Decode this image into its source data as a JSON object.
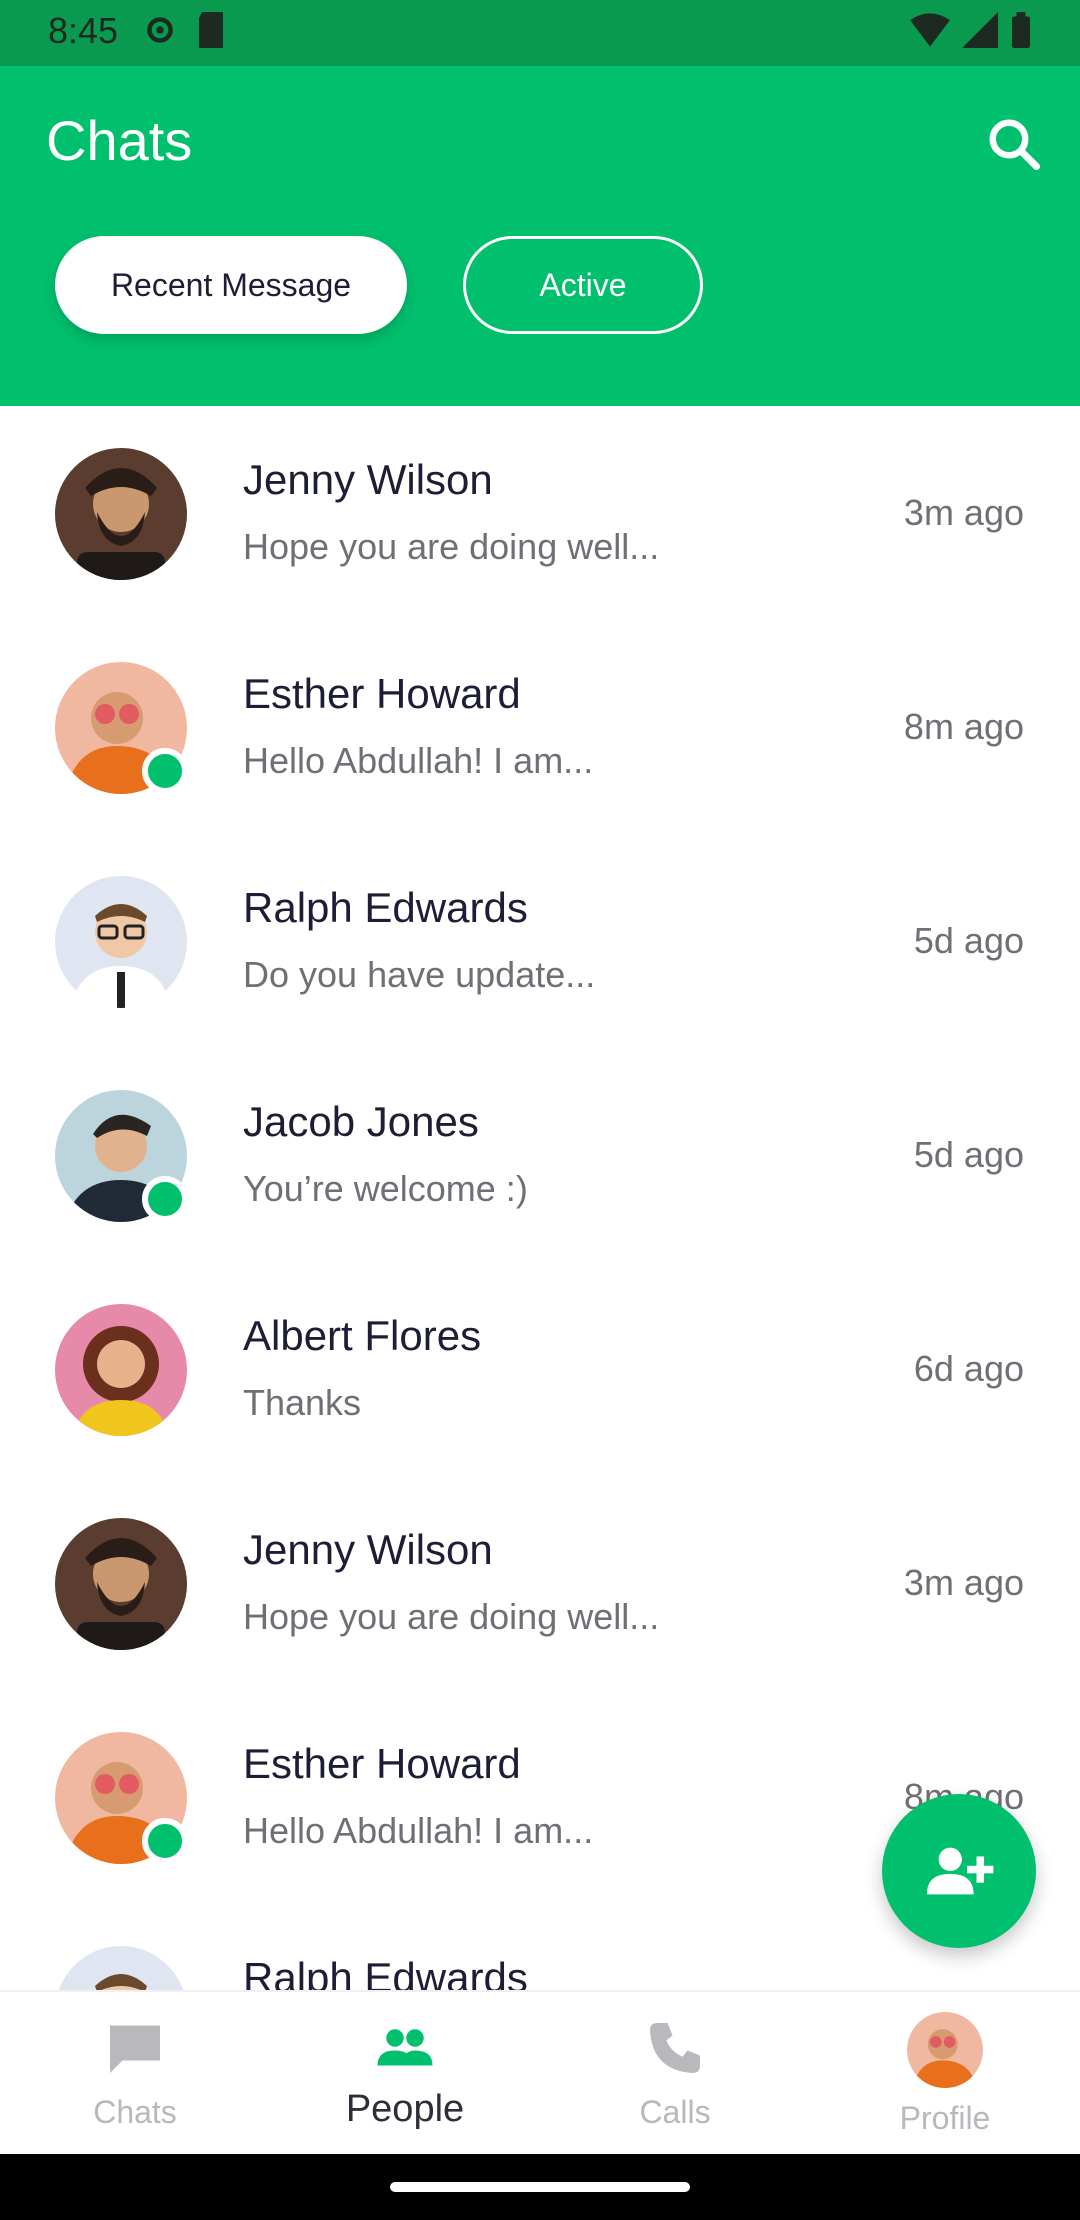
{
  "status_bar": {
    "time": "8:45"
  },
  "header": {
    "title": "Chats"
  },
  "filters": {
    "recent": "Recent Message",
    "active": "Active"
  },
  "chats": [
    {
      "name": "Jenny Wilson",
      "message": "Hope you are doing well...",
      "time": "3m ago",
      "online": false,
      "avatar": "bearded-man"
    },
    {
      "name": "Esther Howard",
      "message": "Hello Abdullah! I am...",
      "time": "8m ago",
      "online": true,
      "avatar": "orange-jacket-man"
    },
    {
      "name": "Ralph Edwards",
      "message": "Do you have update...",
      "time": "5d ago",
      "online": false,
      "avatar": "glasses-man"
    },
    {
      "name": "Jacob Jones",
      "message": "You’re welcome :)",
      "time": "5d ago",
      "online": true,
      "avatar": "suit-man"
    },
    {
      "name": "Albert Flores",
      "message": "Thanks",
      "time": "6d ago",
      "online": false,
      "avatar": "curly-hair-woman"
    },
    {
      "name": "Jenny Wilson",
      "message": "Hope you are doing well...",
      "time": "3m ago",
      "online": false,
      "avatar": "bearded-man"
    },
    {
      "name": "Esther Howard",
      "message": "Hello Abdullah! I am...",
      "time": "8m ago",
      "online": true,
      "avatar": "orange-jacket-man"
    },
    {
      "name": "Ralph Edwards",
      "message": "",
      "time": "",
      "online": false,
      "avatar": "glasses-man"
    }
  ],
  "nav": [
    {
      "label": "Chats",
      "icon": "chat-icon",
      "active": false
    },
    {
      "label": "People",
      "icon": "people-icon",
      "active": true
    },
    {
      "label": "Calls",
      "icon": "phone-icon",
      "active": false
    },
    {
      "label": "Profile",
      "icon": "profile-avatar",
      "active": false
    }
  ],
  "colors": {
    "primary": "#00bf6d",
    "status": "#0a9a4f",
    "text": "#1d1d35",
    "muted": "#6f6f76"
  }
}
